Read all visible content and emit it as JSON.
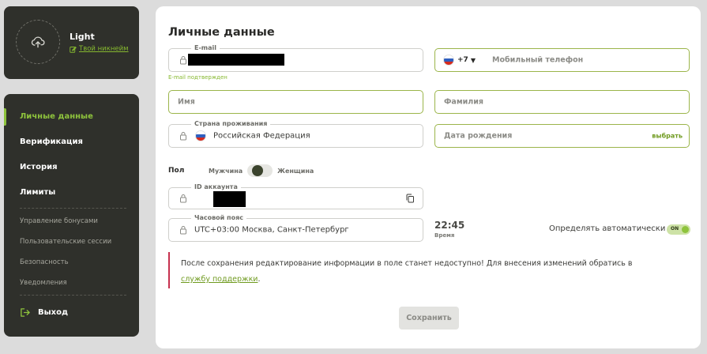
{
  "profile": {
    "name": "Light",
    "nickname_link": "Твой никнейм",
    "avatar_icon": "cloud-upload-icon",
    "edit_icon": "edit-icon"
  },
  "nav": {
    "main_items": [
      {
        "label": "Личные данные",
        "active": true
      },
      {
        "label": "Верификация",
        "active": false
      },
      {
        "label": "История",
        "active": false
      },
      {
        "label": "Лимиты",
        "active": false
      }
    ],
    "sub_items": [
      {
        "label": "Управление бонусами"
      },
      {
        "label": "Пользовательские сессии"
      },
      {
        "label": "Безопасность"
      },
      {
        "label": "Уведомления"
      }
    ],
    "exit_label": "Выход",
    "exit_icon": "logout-icon"
  },
  "main": {
    "title": "Личные данные",
    "email": {
      "label": "E-mail",
      "value_redacted": true,
      "hint": "E-mail подтвержден"
    },
    "phone": {
      "country_code": "+7",
      "placeholder": "Мобильный телефон"
    },
    "first_name": {
      "placeholder": "Имя"
    },
    "last_name": {
      "placeholder": "Фамилия"
    },
    "country": {
      "label": "Страна проживания",
      "value": "Российская Федерация"
    },
    "birth_date": {
      "placeholder": "Дата рождения",
      "action": "выбрать"
    },
    "gender": {
      "label": "Пол",
      "male": "Мужчина",
      "female": "Женщина"
    },
    "account_id": {
      "label": "ID аккаунта",
      "value_redacted": true,
      "copy_icon": "copy-icon"
    },
    "timezone": {
      "label": "Часовой пояс",
      "value": "UTC+03:00 Москва, Санкт-Петербург"
    },
    "time": {
      "value": "22:45",
      "label": "Время"
    },
    "auto_detect": {
      "label": "Определять автоматически",
      "state": "ON"
    },
    "notice": {
      "text": "После сохранения редактирование информации в поле станет недоступно! Для внесения изменений обратись в",
      "link": "службу поддержки",
      "suffix": "."
    },
    "save_label": "Сохранить"
  },
  "colors": {
    "accent": "#8ec33c",
    "sidebar_bg": "#2f302b",
    "warning_bar": "#c6314e"
  }
}
